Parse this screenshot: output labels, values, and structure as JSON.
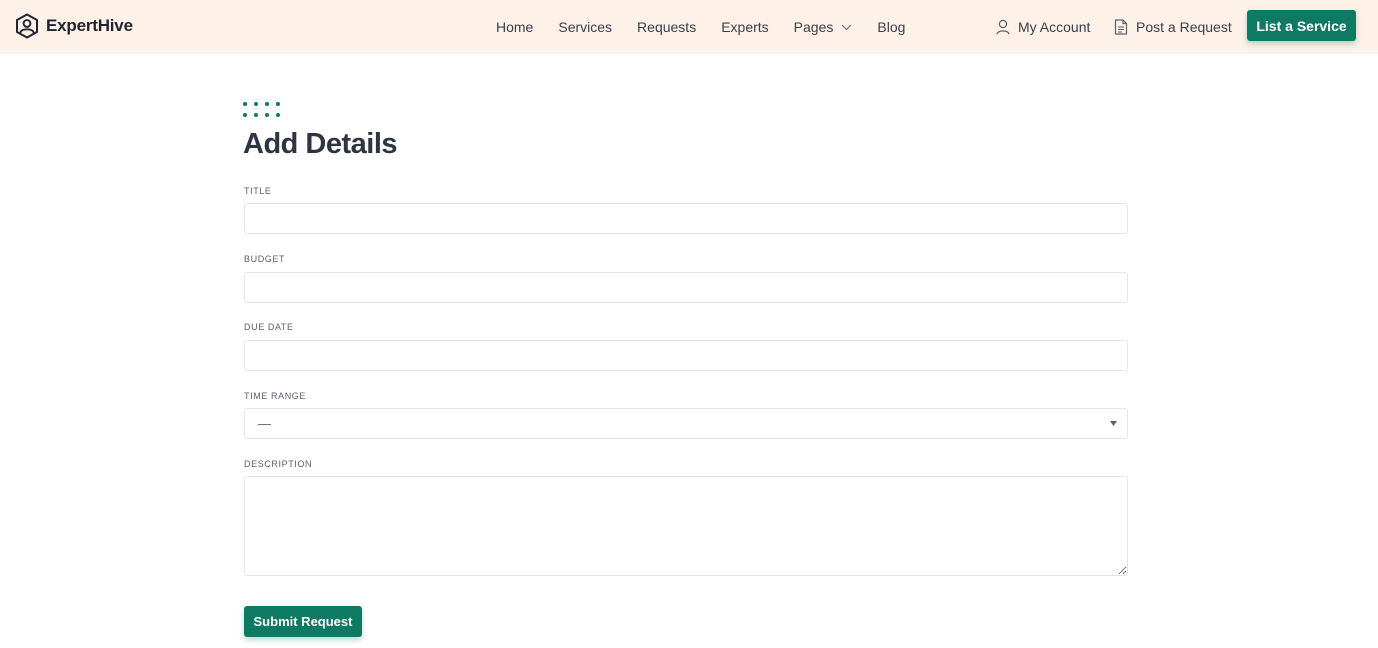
{
  "header": {
    "brand_name": "ExpertHive",
    "brand_icon": "hexagon-user-logo-icon",
    "nav": [
      {
        "label": "Home"
      },
      {
        "label": "Services"
      },
      {
        "label": "Requests"
      },
      {
        "label": "Experts"
      },
      {
        "label": "Pages",
        "has_dropdown": true
      },
      {
        "label": "Blog"
      }
    ],
    "account_label": "My Account",
    "account_icon": "user-icon",
    "post_label": "Post a Request",
    "post_icon": "document-icon",
    "cta_label": "List a Service"
  },
  "form": {
    "title": "Add Details",
    "fields": {
      "title": {
        "label": "Title",
        "value": ""
      },
      "budget": {
        "label": "Budget",
        "value": ""
      },
      "due_date": {
        "label": "Due Date",
        "value": ""
      },
      "time_range": {
        "label": "Time Range",
        "selected": "—"
      },
      "description": {
        "label": "Description",
        "value": ""
      }
    },
    "submit_label": "Submit Request"
  },
  "colors": {
    "accent": "#0e7a64",
    "header_bg": "#fdf1e8",
    "text_dark": "#2f3442"
  }
}
